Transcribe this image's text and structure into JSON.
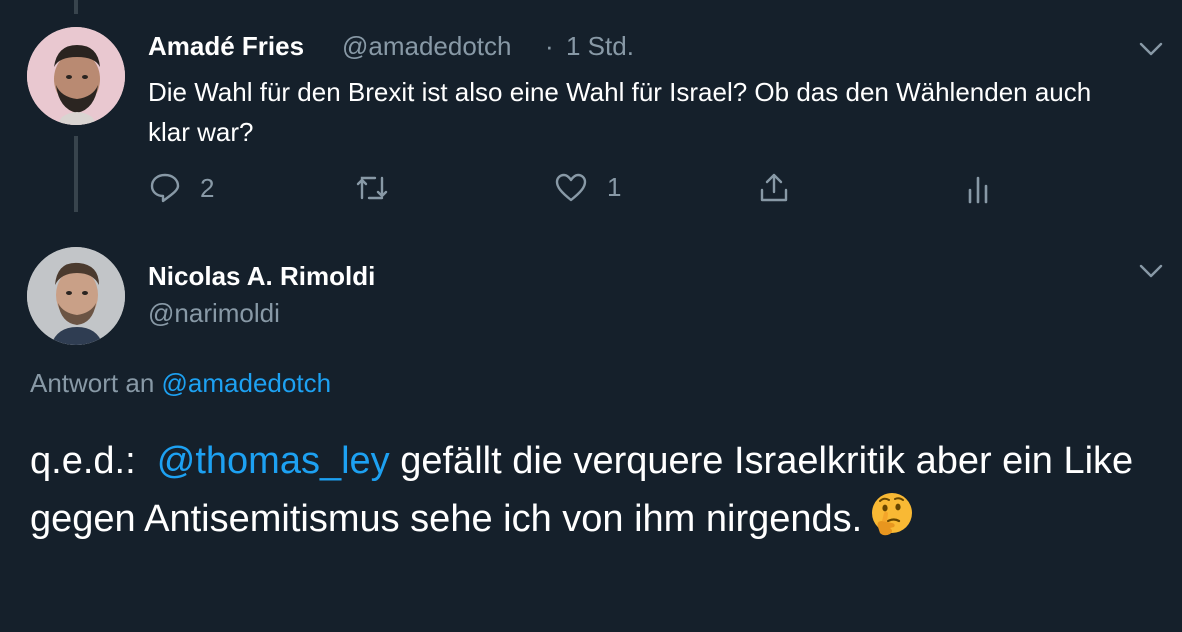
{
  "tweet1": {
    "name": "Amadé Fries",
    "handle": "@amadedotch",
    "separator": "·",
    "time": "1 Std.",
    "text": "Die Wahl für den Brexit ist also eine Wahl für Israel? Ob das den Wählenden auch klar war?",
    "actions": {
      "reply_count": "2",
      "retweet_count": "",
      "like_count": "1"
    }
  },
  "tweet2": {
    "name": "Nicolas A. Rimoldi",
    "handle": "@narimoldi",
    "reply_prefix": "Antwort an",
    "reply_to": "@amadedotch",
    "text_prefix": "q.e.d.:",
    "mention": "@thomas_ley",
    "text_rest": "gefällt die verquere Israelkritik aber ein Like gegen Antisemitismus sehe ich von ihm nirgends.",
    "emoji": "thinking-face"
  },
  "colors": {
    "background": "#15202b",
    "text_primary": "#ffffff",
    "text_secondary": "#8899a6",
    "link": "#1da1f2",
    "thread_line": "#38444d"
  }
}
